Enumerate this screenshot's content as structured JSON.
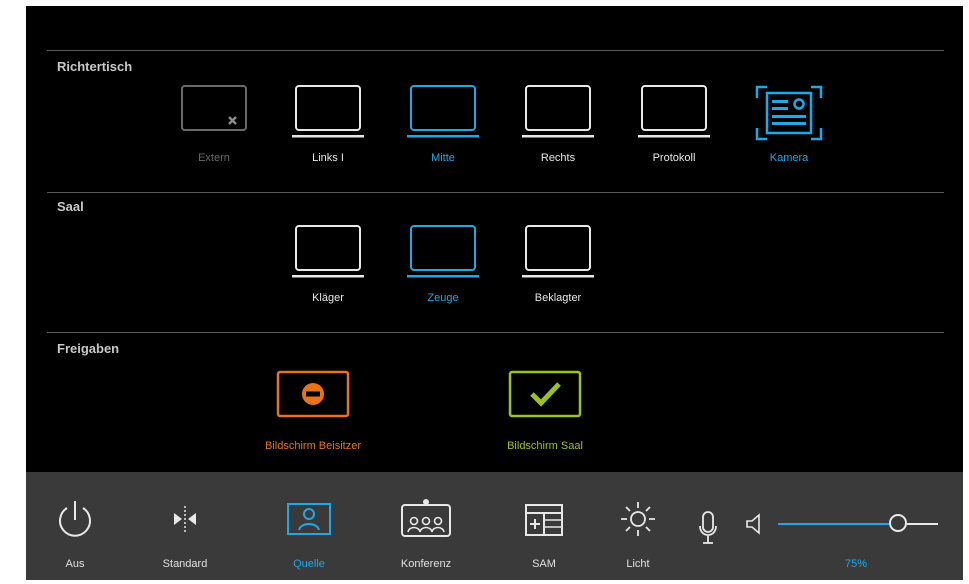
{
  "sections": {
    "richtertisch": "Richtertisch",
    "saal": "Saal",
    "freigaben": "Freigaben"
  },
  "richtertisch_devices": [
    {
      "label": "Extern",
      "state": "disabled",
      "icon": "laptop-disconnected-icon"
    },
    {
      "label": "Links I",
      "state": "normal",
      "icon": "laptop-icon"
    },
    {
      "label": "Mitte",
      "state": "selected",
      "icon": "laptop-icon"
    },
    {
      "label": "Rechts",
      "state": "normal",
      "icon": "laptop-icon"
    },
    {
      "label": "Protokoll",
      "state": "normal",
      "icon": "laptop-icon"
    },
    {
      "label": "Kamera",
      "state": "selected",
      "icon": "document-camera-icon"
    }
  ],
  "saal_devices": [
    {
      "label": "Kläger",
      "state": "normal",
      "icon": "laptop-icon"
    },
    {
      "label": "Zeuge",
      "state": "selected",
      "icon": "laptop-icon"
    },
    {
      "label": "Beklagter",
      "state": "normal",
      "icon": "laptop-icon"
    }
  ],
  "shares": [
    {
      "label": "Bildschirm Beisitzer",
      "icon": "blocked-icon",
      "color": "#e8731a"
    },
    {
      "label": "Bildschirm Saal",
      "icon": "checkmark-icon",
      "color": "#9cc21f"
    }
  ],
  "bottom_bar": [
    {
      "label": "Aus",
      "icon": "power-icon"
    },
    {
      "label": "Standard",
      "icon": "standard-split-icon"
    },
    {
      "label": "Quelle",
      "icon": "source-person-icon",
      "selected": true
    },
    {
      "label": "Konferenz",
      "icon": "conference-icon"
    },
    {
      "label": "SAM",
      "icon": "sam-table-icon"
    },
    {
      "label": "Licht",
      "icon": "light-sun-icon"
    }
  ],
  "volume": {
    "percent_label": "75%",
    "level": 0.75
  },
  "colors": {
    "accent": "#1ea8e6",
    "orange": "#e8731a",
    "green": "#9cc21f",
    "disabled": "#6a6a6a"
  }
}
